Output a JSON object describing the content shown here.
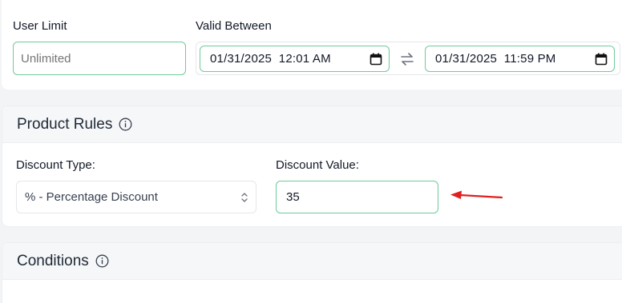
{
  "limits": {
    "user_limit_label": "User Limit",
    "user_limit_placeholder": "Unlimited",
    "valid_between_label": "Valid Between",
    "valid_from": "01/31/2025  12:01 AM",
    "valid_to": "01/31/2025  11:59 PM"
  },
  "product_rules": {
    "title": "Product Rules",
    "discount_type_label": "Discount Type:",
    "discount_type_value": "% - Percentage Discount",
    "discount_value_label": "Discount Value:",
    "discount_value": "35"
  },
  "conditions": {
    "title": "Conditions"
  },
  "colors": {
    "accent_border": "#6ecb9a",
    "annotation_arrow": "#e02020"
  },
  "icons": [
    "calendar-icon",
    "swap-icon",
    "info-icon",
    "select-chevron-icon",
    "annotation-arrow"
  ]
}
